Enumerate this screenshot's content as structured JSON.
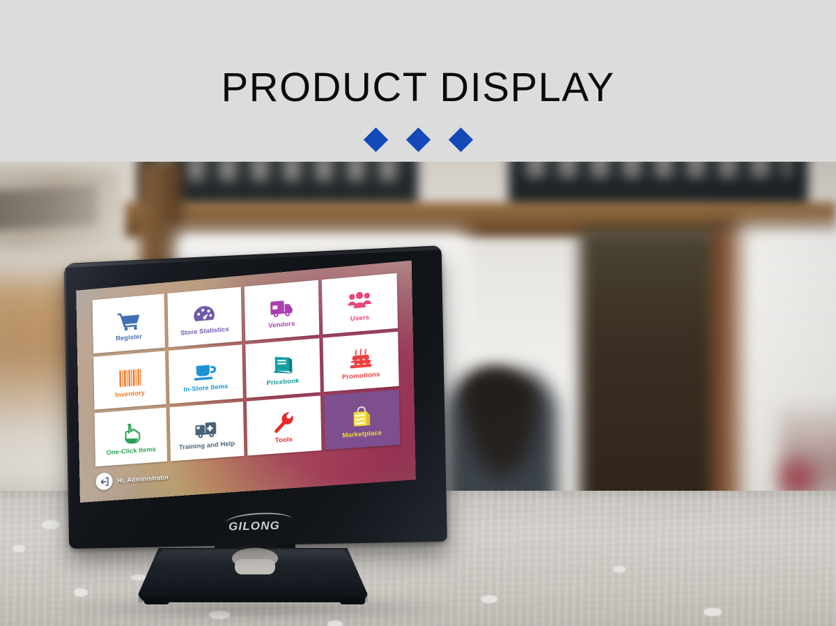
{
  "header": {
    "title": "PRODUCT DISPLAY",
    "diamond_count": 3,
    "diamond_color": "#1449ba",
    "band_color": "#dcdcdc"
  },
  "device": {
    "brand_logo": "GILONG",
    "type": "touchscreen-pos-terminal",
    "bezel_color": "#13161b"
  },
  "pos_screen": {
    "wallpaper": "blurred-cafe-photo",
    "status_bar": {
      "icon": "logout-back-icon",
      "text": "Hi, Administrator"
    },
    "tiles": [
      {
        "label": "Register",
        "icon": "shopping-cart-icon",
        "color": "#3f6fb5",
        "tile_bg": "#ffffff"
      },
      {
        "label": "Store Statistics",
        "icon": "gauge-icon",
        "color": "#6f58ab",
        "tile_bg": "#ffffff"
      },
      {
        "label": "Vendors",
        "icon": "delivery-truck-icon",
        "color": "#a93fb0",
        "tile_bg": "#ffffff"
      },
      {
        "label": "Users",
        "icon": "users-group-icon",
        "color": "#e8447f",
        "tile_bg": "#ffffff"
      },
      {
        "label": "Inventory",
        "icon": "barcode-icon",
        "color": "#ef7622",
        "tile_bg": "#ffffff"
      },
      {
        "label": "In-Store Items",
        "icon": "coffee-cup-icon",
        "color": "#1d92d4",
        "tile_bg": "#ffffff"
      },
      {
        "label": "Pricebook",
        "icon": "book-icon",
        "color": "#1a9a9a",
        "tile_bg": "#ffffff"
      },
      {
        "label": "Promotions",
        "icon": "birthday-cake-icon",
        "color": "#ec4040",
        "tile_bg": "#ffffff"
      },
      {
        "label": "One-Click Items",
        "icon": "pointing-hand-icon",
        "color": "#2aa052",
        "tile_bg": "#ffffff"
      },
      {
        "label": "Training and Help",
        "icon": "ambulance-icon",
        "color": "#4a6275",
        "tile_bg": "#ffffff"
      },
      {
        "label": "Tools",
        "icon": "wrench-icon",
        "color": "#e52b2b",
        "tile_bg": "#ffffff"
      },
      {
        "label": "Marketplace",
        "icon": "shopping-bag-icon",
        "color": "#f2da3c",
        "tile_bg": "#7d4f8e"
      }
    ]
  },
  "scene": {
    "setting": "blurred coffee shop interior with wooden beams, chalkboard menus and a stone counter",
    "counter_surface": "grey stone countertop"
  }
}
